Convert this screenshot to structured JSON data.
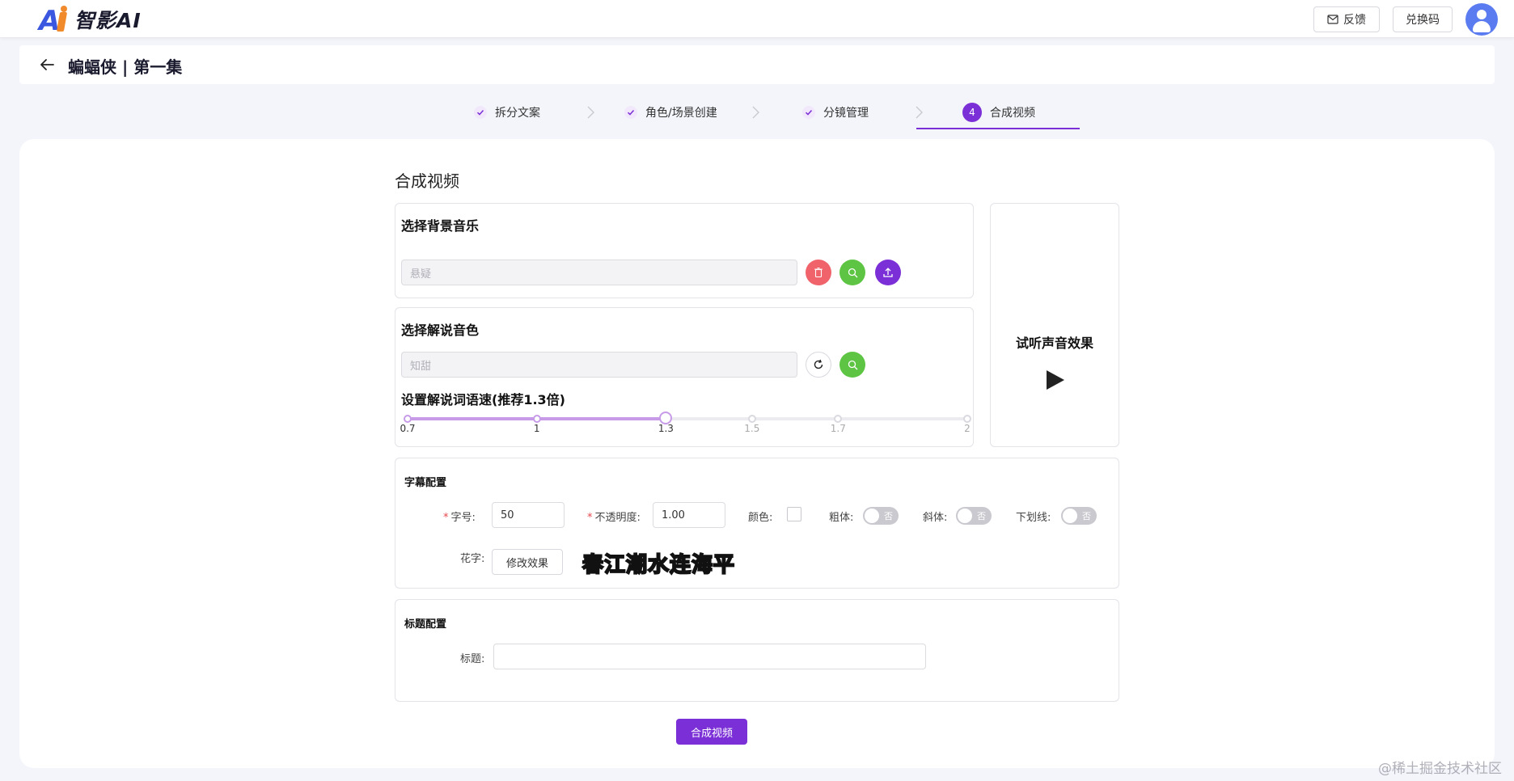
{
  "app": {
    "logo_text": "智影AI"
  },
  "topbar": {
    "feedback_label": "反馈",
    "redeem_label": "兑换码"
  },
  "header": {
    "title": "蝙蝠侠 | 第一集"
  },
  "steps": [
    {
      "label": "拆分文案",
      "state": "done"
    },
    {
      "label": "角色/场景创建",
      "state": "done"
    },
    {
      "label": "分镜管理",
      "state": "done"
    },
    {
      "label": "合成视频",
      "state": "active",
      "number": "4"
    }
  ],
  "main": {
    "section_title": "合成视频",
    "bgm": {
      "title": "选择背景音乐",
      "placeholder": "悬疑"
    },
    "voice": {
      "title": "选择解说音色",
      "placeholder": "知甜"
    },
    "speed": {
      "title": "设置解说词语速(推荐1.3倍)",
      "ticks": [
        "0.7",
        "1",
        "1.3",
        "1.5",
        "1.7",
        "2"
      ],
      "value": 1.3,
      "min": 0.7,
      "max": 2
    },
    "preview": {
      "title": "试听声音效果"
    },
    "subtitle": {
      "title": "字幕配置",
      "font_size_label": "字号:",
      "font_size_value": "50",
      "opacity_label": "不透明度:",
      "opacity_value": "1.00",
      "color_label": "颜色:",
      "bold_label": "粗体:",
      "italic_label": "斜体:",
      "underline_label": "下划线:",
      "toggle_off_text": "否",
      "fancy_label": "花字:",
      "modify_effect_label": "修改效果",
      "sample_text": "春江潮水连海平"
    },
    "title_config": {
      "title": "标题配置",
      "label": "标题:",
      "value": ""
    },
    "submit_label": "合成视频"
  },
  "watermark": "@稀土掘金技术社区",
  "colors": {
    "accent": "#7b2fd6",
    "delete": "#f0636b",
    "search": "#5ec443",
    "slider": "#c79be8"
  }
}
